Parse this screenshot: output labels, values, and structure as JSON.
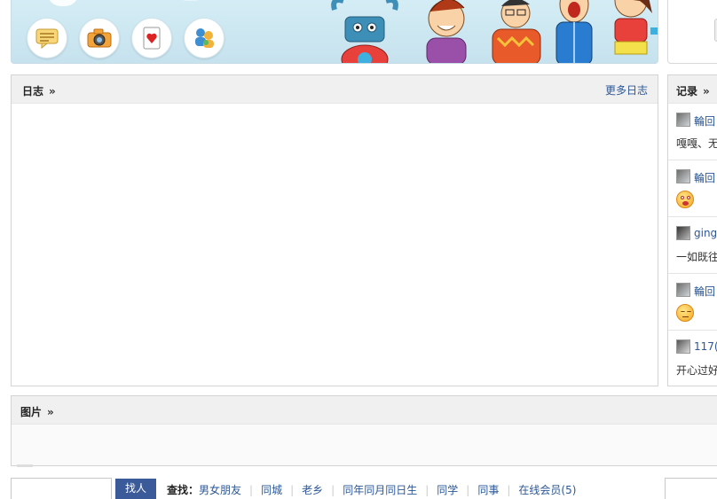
{
  "banner": {
    "apps": [
      {
        "name": "message-app-icon"
      },
      {
        "name": "camera-app-icon"
      },
      {
        "name": "card-game-app-icon"
      },
      {
        "name": "friends-app-icon"
      }
    ]
  },
  "diary": {
    "title": "日志",
    "more": "更多日志"
  },
  "records": {
    "title": "记录",
    "items": [
      {
        "name": "輪回",
        "text": "嘎嘎、无"
      },
      {
        "name": "輪回",
        "emoji": "shocked-emoji"
      },
      {
        "name": "ging",
        "text": "一如既往"
      },
      {
        "name": "輪回",
        "emoji": "sleepy-emoji"
      },
      {
        "name": "117(",
        "text": "开心过好"
      }
    ]
  },
  "photos": {
    "title": "图片"
  },
  "finder": {
    "button": "找人",
    "label": "查找：",
    "links": [
      "男女朋友",
      "同城",
      "老乡",
      "同年同月同日生",
      "同学",
      "同事",
      "在线会员(5)"
    ]
  },
  "colors": {
    "link": "#2b5797",
    "button": "#3b5a9a",
    "panel_head": "#f0f0f0"
  }
}
